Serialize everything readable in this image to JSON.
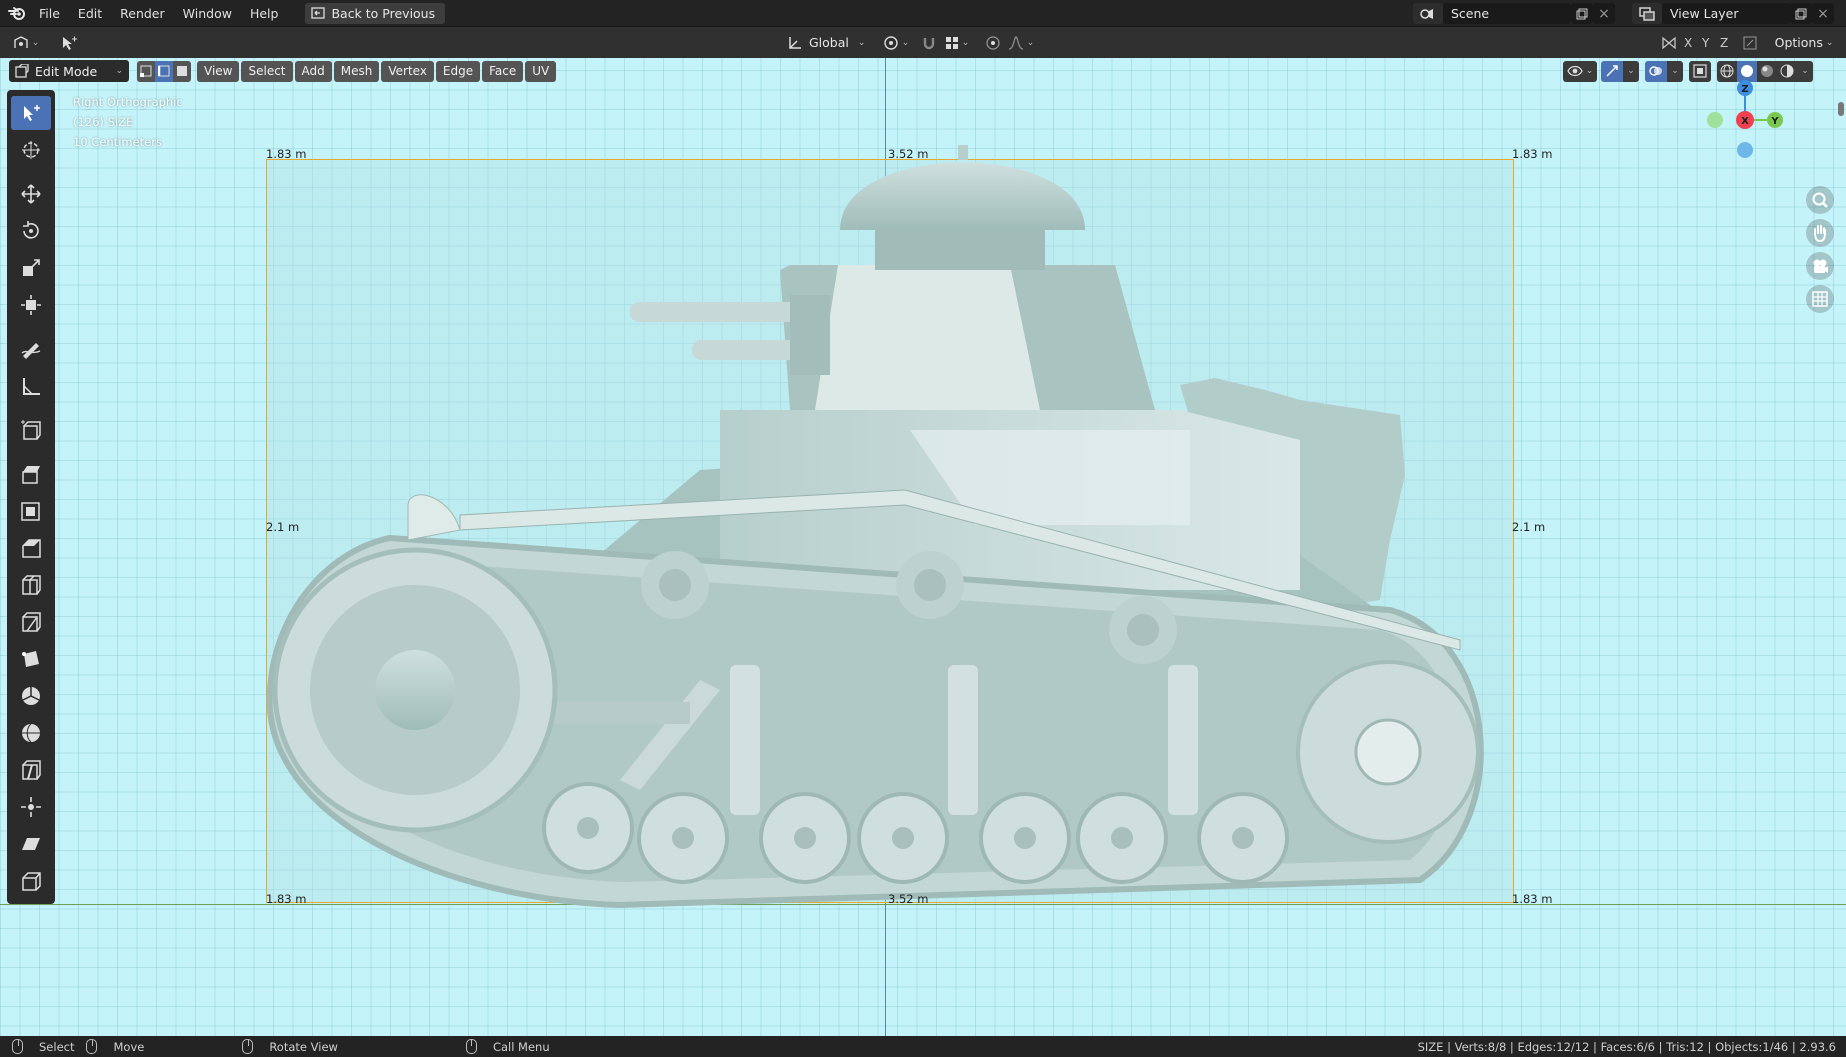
{
  "menubar": {
    "items": [
      "File",
      "Edit",
      "Render",
      "Window",
      "Help"
    ],
    "back_button": "Back to Previous",
    "scene_name": "Scene",
    "view_layer": "View Layer"
  },
  "header": {
    "orientation": "Global",
    "axes": [
      "X",
      "Y",
      "Z"
    ],
    "options_label": "Options"
  },
  "viewport_header": {
    "mode": "Edit Mode",
    "menus": [
      "View",
      "Select",
      "Add",
      "Mesh",
      "Vertex",
      "Edge",
      "Face",
      "UV"
    ]
  },
  "viewport": {
    "view_name": "Right Orthographic",
    "object_info": "(126) SIZE",
    "grid_scale": "10 Centimeters",
    "dims": {
      "top_left": "1.83 m",
      "top_center": "3.52 m",
      "top_right": "1.83 m",
      "mid_left": "2.1 m",
      "mid_right": "2.1 m",
      "bottom_left": "1.83 m",
      "bottom_center": "3.52 m",
      "bottom_right": "1.83 m"
    },
    "gizmo": {
      "z": "Z",
      "x": "X",
      "y": "Y"
    }
  },
  "statusbar": {
    "select": "Select",
    "move": "Move",
    "rotate": "Rotate View",
    "call_menu": "Call Menu",
    "stats": "SIZE | Verts:8/8 | Edges:12/12 | Faces:6/6 | Tris:12 | Objects:1/46 | 2.93.6"
  },
  "colors": {
    "viewport_bg": "#c4f4fa",
    "active_tool": "#4a72b4",
    "axis_x": "#f0404f",
    "axis_y": "#7ac94f",
    "axis_z": "#3c8ee0",
    "selection_outline": "#f0a020"
  }
}
